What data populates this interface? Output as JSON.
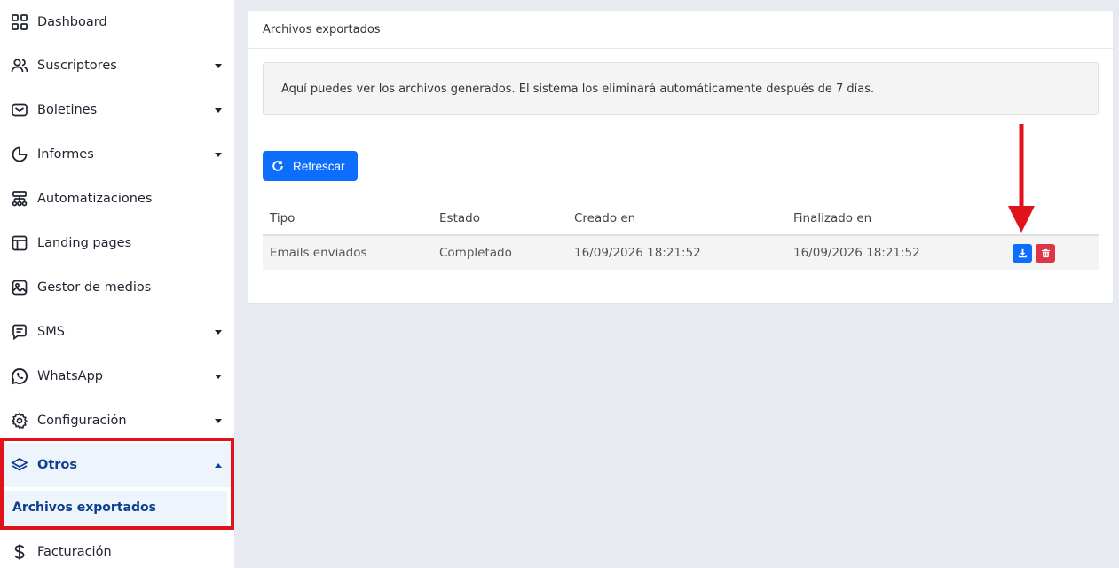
{
  "sidebar": {
    "items": [
      {
        "label": "Dashboard",
        "icon": "grid-icon",
        "caret": false
      },
      {
        "label": "Suscriptores",
        "icon": "users-icon",
        "caret": true
      },
      {
        "label": "Boletines",
        "icon": "mail-icon",
        "caret": true
      },
      {
        "label": "Informes",
        "icon": "pie-chart-icon",
        "caret": true
      },
      {
        "label": "Automatizaciones",
        "icon": "flow-icon",
        "caret": false
      },
      {
        "label": "Landing pages",
        "icon": "layout-icon",
        "caret": false
      },
      {
        "label": "Gestor de medios",
        "icon": "image-icon",
        "caret": false
      },
      {
        "label": "SMS",
        "icon": "message-icon",
        "caret": true
      },
      {
        "label": "WhatsApp",
        "icon": "whatsapp-icon",
        "caret": true
      },
      {
        "label": "Configuración",
        "icon": "gear-icon",
        "caret": true
      },
      {
        "label": "Otros",
        "icon": "layers-icon",
        "caret": true,
        "active": true
      },
      {
        "label": "Facturación",
        "icon": "dollar-icon",
        "caret": false
      }
    ],
    "submenu_label": "Archivos exportados"
  },
  "card": {
    "title": "Archivos exportados",
    "alert": "Aquí puedes ver los archivos generados. El sistema los eliminará automáticamente después de 7 días.",
    "refresh_label": "Refrescar"
  },
  "table": {
    "headers": [
      "Tipo",
      "Estado",
      "Creado en",
      "Finalizado en"
    ],
    "rows": [
      {
        "tipo": "Emails enviados",
        "estado": "Completado",
        "creado": "16/09/2026 18:21:52",
        "finalizado": "16/09/2026 18:21:52"
      }
    ]
  },
  "colors": {
    "primary": "#0d6efd",
    "danger": "#dc3545",
    "highlight": "#e0121b",
    "active_text": "#0d3f8f"
  }
}
